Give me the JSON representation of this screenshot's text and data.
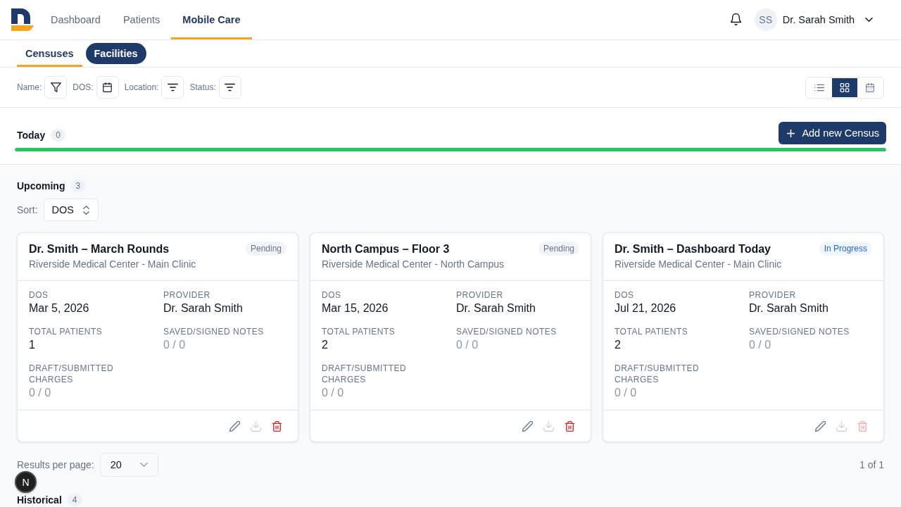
{
  "nav": {
    "tabs": [
      {
        "label": "Dashboard",
        "selected": false
      },
      {
        "label": "Patients",
        "selected": false
      },
      {
        "label": "Mobile Care",
        "selected": true
      }
    ],
    "user": {
      "initials": "SS",
      "name": "Dr. Sarah Smith"
    }
  },
  "subtabs": [
    {
      "label": "Censuses",
      "selected": true,
      "highlighted": false
    },
    {
      "label": "Facilities",
      "selected": false,
      "highlighted": true
    }
  ],
  "filters": [
    {
      "label": "Name:",
      "kind": "funnel"
    },
    {
      "label": "DOS:",
      "kind": "calendar"
    },
    {
      "label": "Location:",
      "kind": "lines"
    },
    {
      "label": "Status:",
      "kind": "lines"
    }
  ],
  "view_toggle": [
    {
      "kind": "list",
      "selected": false
    },
    {
      "kind": "grid",
      "selected": true
    },
    {
      "kind": "calendar",
      "selected": false
    }
  ],
  "today": {
    "title": "Today",
    "count": "0",
    "add_button": "Add new Census",
    "progress": {
      "level": 1
    }
  },
  "upcoming": {
    "title": "Upcoming",
    "count": "3",
    "sort": {
      "label": "Sort:",
      "value": "DOS"
    },
    "cards": [
      {
        "title": "Dr. Smith – March Rounds",
        "location": "Riverside Medical Center - Main Clinic",
        "status": {
          "label": "Pending",
          "kind": "pending"
        },
        "fields": [
          {
            "label": "DOS",
            "value": "Mar 5, 2026",
            "muted": false
          },
          {
            "label": "PROVIDER",
            "value": "Dr. Sarah Smith",
            "muted": false
          },
          {
            "label": "TOTAL PATIENTS",
            "value": "1",
            "muted": false
          },
          {
            "label": "SAVED/SIGNED NOTES",
            "value": "0 / 0",
            "muted": true
          },
          {
            "label": "DRAFT/SUBMITTED CHARGES",
            "value": "0 / 0",
            "muted": true
          }
        ],
        "actions": [
          {
            "kind": "edit",
            "disabled": false
          },
          {
            "kind": "download",
            "disabled": true
          },
          {
            "kind": "delete",
            "disabled": false
          }
        ]
      },
      {
        "title": "North Campus – Floor 3",
        "location": "Riverside Medical Center - North Campus",
        "status": {
          "label": "Pending",
          "kind": "pending"
        },
        "fields": [
          {
            "label": "DOS",
            "value": "Mar 15, 2026",
            "muted": false
          },
          {
            "label": "PROVIDER",
            "value": "Dr. Sarah Smith",
            "muted": false
          },
          {
            "label": "TOTAL PATIENTS",
            "value": "2",
            "muted": false
          },
          {
            "label": "SAVED/SIGNED NOTES",
            "value": "0 / 0",
            "muted": true
          },
          {
            "label": "DRAFT/SUBMITTED CHARGES",
            "value": "0 / 0",
            "muted": true
          }
        ],
        "actions": [
          {
            "kind": "edit",
            "disabled": false
          },
          {
            "kind": "download",
            "disabled": true
          },
          {
            "kind": "delete",
            "disabled": false
          }
        ]
      },
      {
        "title": "Dr. Smith – Dashboard Today",
        "location": "Riverside Medical Center - Main Clinic",
        "status": {
          "label": "In Progress",
          "kind": "in_progress"
        },
        "fields": [
          {
            "label": "DOS",
            "value": "Jul 21, 2026",
            "muted": false
          },
          {
            "label": "PROVIDER",
            "value": "Dr. Sarah Smith",
            "muted": false
          },
          {
            "label": "TOTAL PATIENTS",
            "value": "2",
            "muted": false
          },
          {
            "label": "SAVED/SIGNED NOTES",
            "value": "0 / 0",
            "muted": true
          },
          {
            "label": "DRAFT/SUBMITTED CHARGES",
            "value": "0 / 0",
            "muted": true
          }
        ],
        "actions": [
          {
            "kind": "edit",
            "disabled": false
          },
          {
            "kind": "download",
            "disabled": true
          },
          {
            "kind": "delete",
            "disabled": true
          }
        ]
      }
    ],
    "results_per_page": {
      "label": "Results per page:",
      "value": "20"
    },
    "pagination": "1 of 1"
  },
  "historical": {
    "title": "Historical",
    "count": "4"
  },
  "dev_badge": {
    "label": "N"
  }
}
